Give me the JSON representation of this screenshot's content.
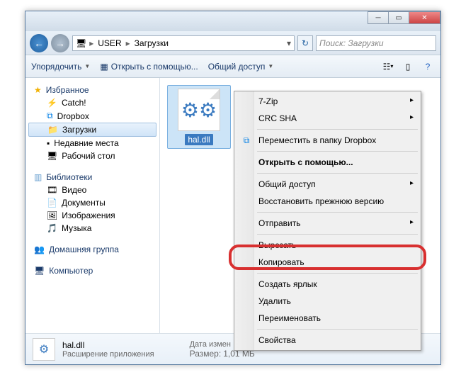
{
  "breadcrumb": {
    "seg1": "USER",
    "seg2": "Загрузки"
  },
  "search": {
    "placeholder": "Поиск: Загрузки"
  },
  "toolbar": {
    "organize": "Упорядочить",
    "openwith": "Открыть с помощью...",
    "share": "Общий доступ"
  },
  "sidebar": {
    "favorites": "Избранное",
    "catch": "Catch!",
    "dropbox": "Dropbox",
    "downloads": "Загрузки",
    "recent": "Недавние места",
    "desktop": "Рабочий стол",
    "libraries": "Библиотеки",
    "videos": "Видео",
    "documents": "Документы",
    "pictures": "Изображения",
    "music": "Музыка",
    "homegroup": "Домашняя группа",
    "computer": "Компьютер"
  },
  "file": {
    "name": "hal.dll"
  },
  "status": {
    "name": "hal.dll",
    "type": "Расширение приложения",
    "date_label": "Дата измен",
    "size_label": "Размер:",
    "size_value": "1,01 МБ"
  },
  "context": {
    "zip": "7-Zip",
    "crc": "CRC SHA",
    "move_dropbox": "Переместить в папку Dropbox",
    "openwith": "Открыть с помощью...",
    "share": "Общий доступ",
    "restore": "Восстановить прежнюю версию",
    "sendto": "Отправить",
    "cut": "Вырезать",
    "copy": "Копировать",
    "shortcut": "Создать ярлык",
    "delete": "Удалить",
    "rename": "Переименовать",
    "properties": "Свойства"
  }
}
